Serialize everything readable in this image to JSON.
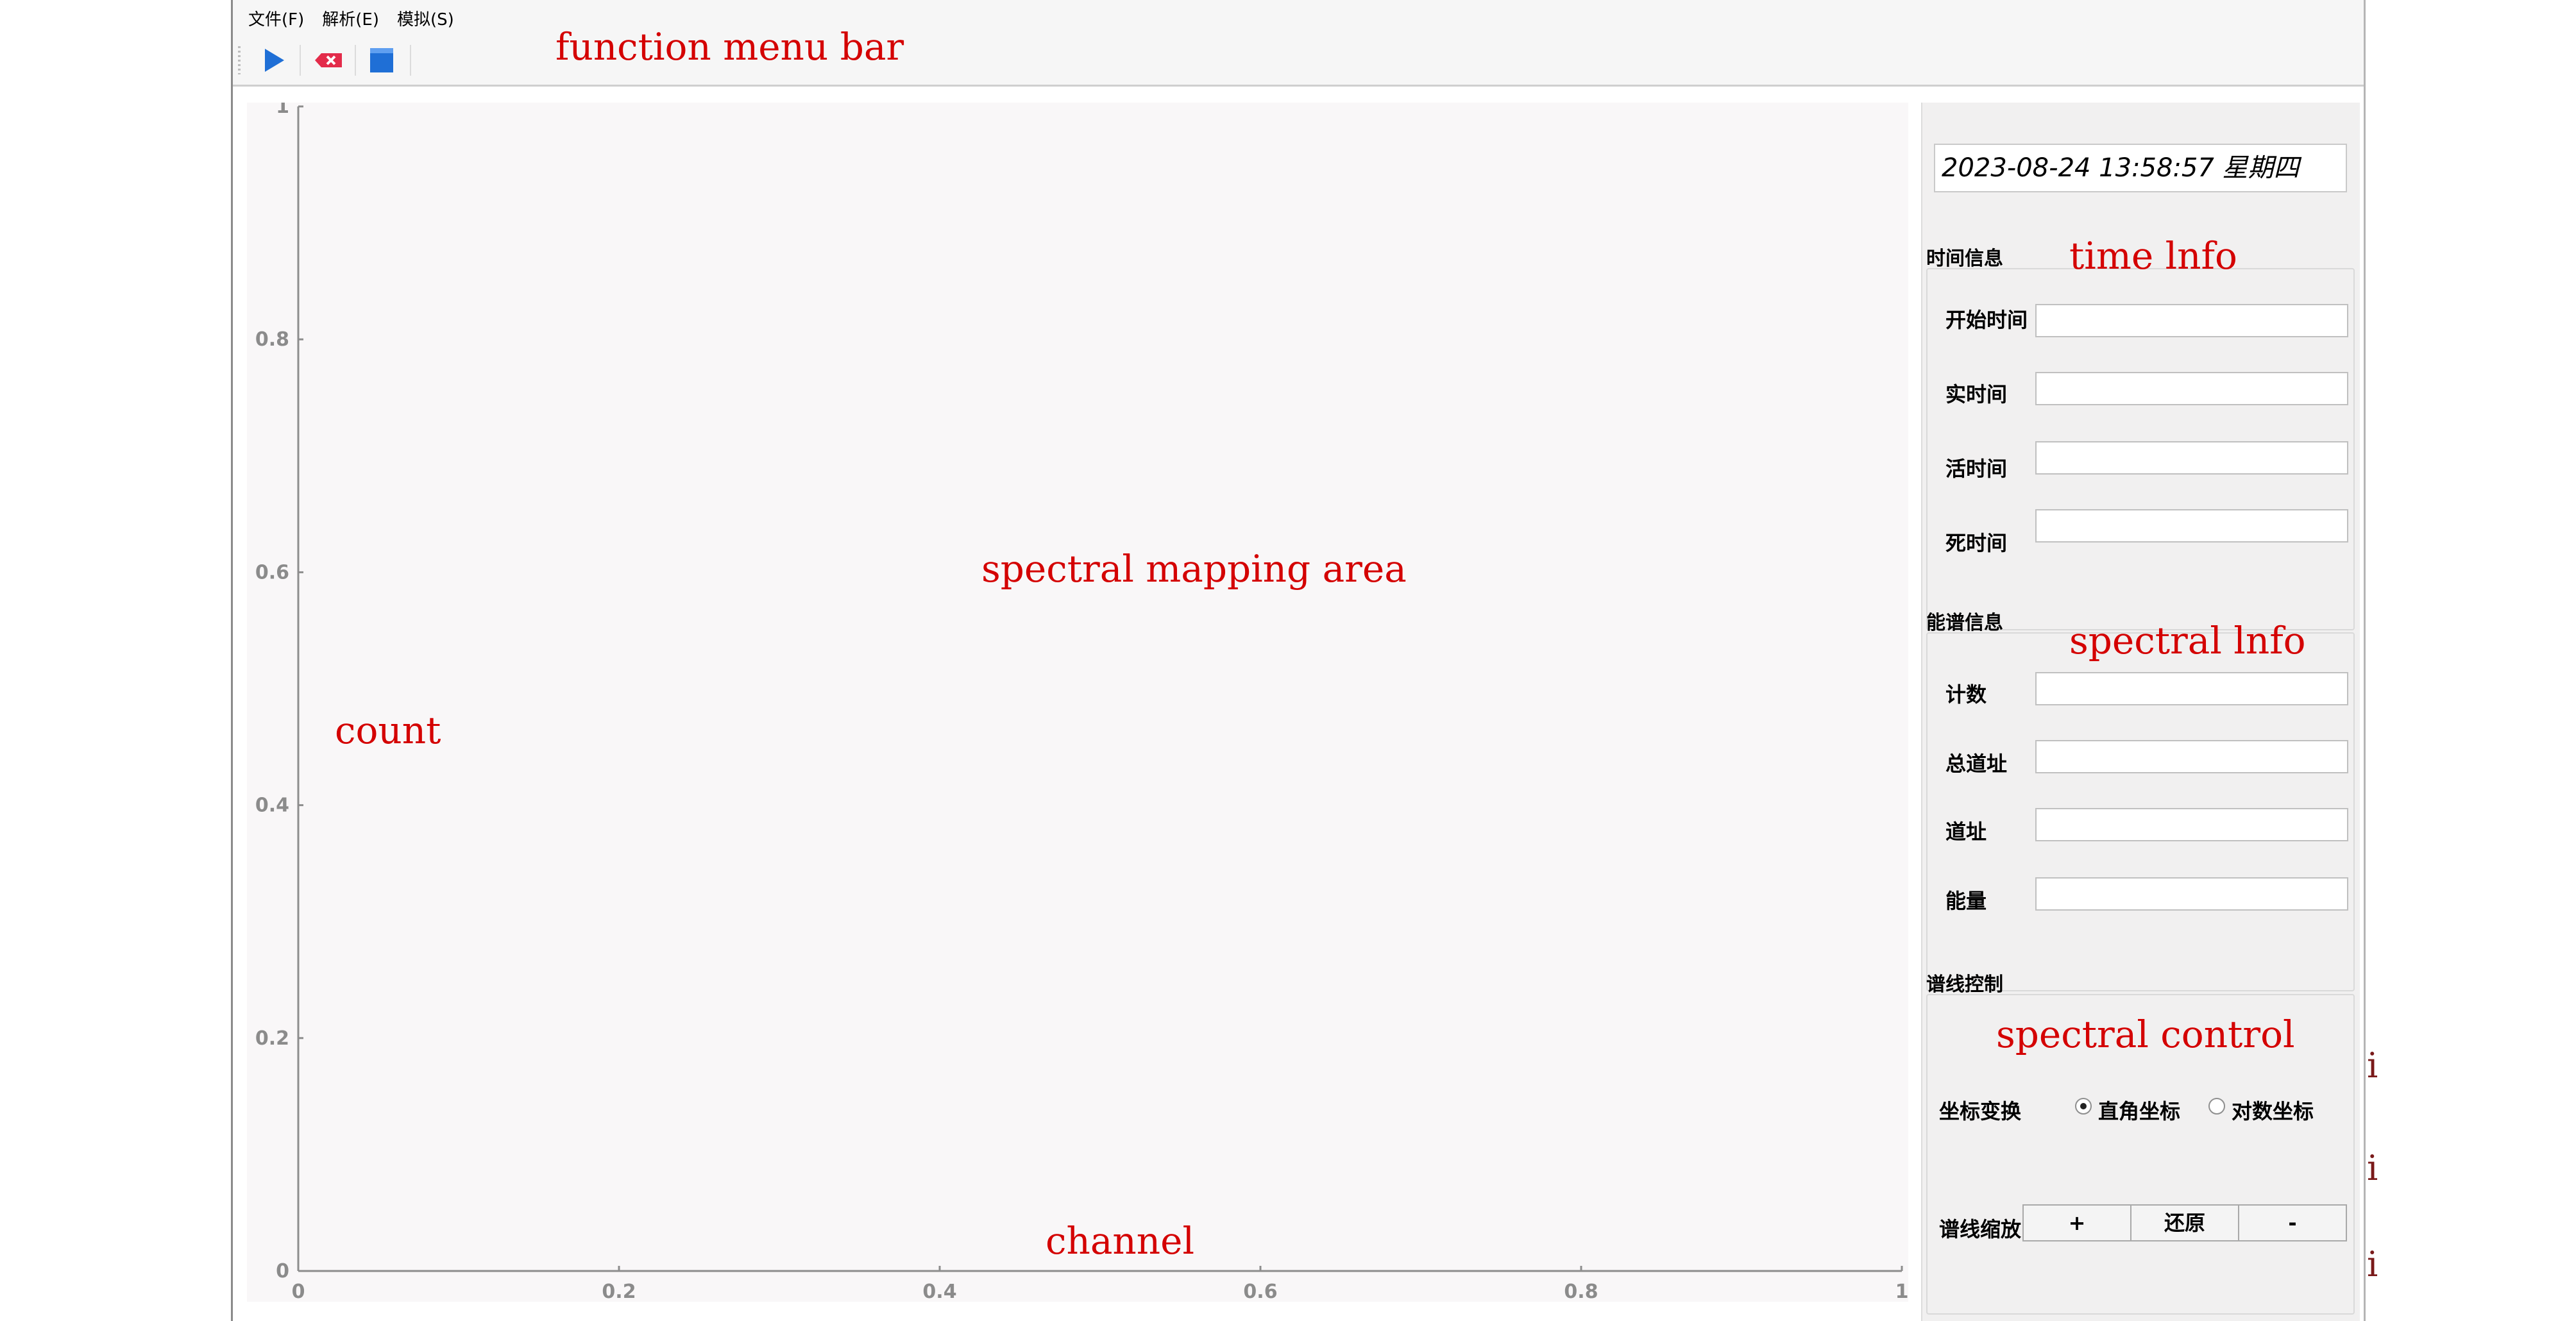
{
  "menu": {
    "file": "文件(F)",
    "parse": "解析(E)",
    "simulate": "模拟(S)"
  },
  "toolbar": {
    "start_icon": "play-icon",
    "clear_icon": "clear-icon",
    "stop_icon": "stop-icon"
  },
  "annotations": {
    "menu_bar": "function menu bar",
    "mapping_area": "spectral mapping area",
    "y_axis": "count",
    "x_axis": "channel",
    "time_info": "time lnfo",
    "spectral_info": "spectral lnfo",
    "spectral_control": "spectral control"
  },
  "chart_data": {
    "type": "line",
    "series": [],
    "xlim": [
      0,
      1
    ],
    "ylim": [
      0,
      1
    ],
    "x_ticks": [
      "0",
      "0.2",
      "0.4",
      "0.6",
      "0.8",
      "1"
    ],
    "y_ticks": [
      "0",
      "0.2",
      "0.4",
      "0.6",
      "0.8",
      "1"
    ],
    "grid": false
  },
  "panel": {
    "datetime": "2023-08-24 13:58:57 星期四",
    "time_group": {
      "title": "时间信息",
      "fields": [
        {
          "label": "开始时间",
          "value": ""
        },
        {
          "label": "实时间",
          "value": ""
        },
        {
          "label": "活时间",
          "value": ""
        },
        {
          "label": "死时间",
          "value": ""
        }
      ]
    },
    "spectrum_group": {
      "title": "能谱信息",
      "fields": [
        {
          "label": "计数",
          "value": ""
        },
        {
          "label": "总道址",
          "value": ""
        },
        {
          "label": "道址",
          "value": ""
        },
        {
          "label": "能量",
          "value": ""
        }
      ]
    },
    "control_group": {
      "title": "谱线控制",
      "coord_label": "坐标变换",
      "coord_options": [
        {
          "label": "直角坐标",
          "selected": true
        },
        {
          "label": "对数坐标",
          "selected": false
        }
      ],
      "zoom_label": "谱线缩放",
      "zoom_in": "+",
      "reset": "还原",
      "zoom_out": "-"
    }
  },
  "cutoff_text": [
    "i",
    "i",
    "i"
  ]
}
